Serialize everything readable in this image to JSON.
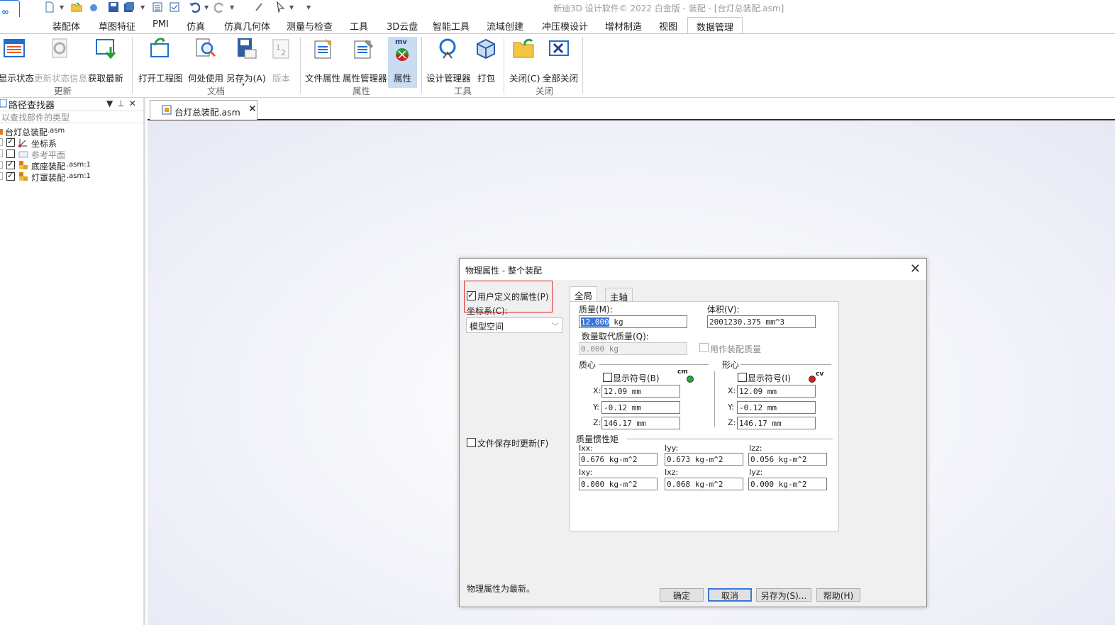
{
  "window": {
    "title": "新迪3D 设计软件© 2022 白金版 - 装配 - [台灯总装配.asm]"
  },
  "tabs": [
    "装配体",
    "草图特征",
    "PMI",
    "仿真",
    "仿真几何体",
    "测量与检查",
    "工具",
    "3D云盘",
    "智能工具",
    "流域创建",
    "冲压模设计",
    "增材制造",
    "视图",
    "数据管理"
  ],
  "active_tab": "数据管理",
  "ribbon": {
    "buttons": [
      "显示状态",
      "更新状态信息",
      "获取最新",
      "打开工程图",
      "何处使用",
      "另存为(A)",
      "版本",
      "文件属性",
      "属性管理器",
      "属性",
      "设计管理器",
      "打包",
      "关闭(C)",
      "全部关闭"
    ],
    "mv_badge": "mv",
    "groups": [
      "更新",
      "文档",
      "属性",
      "工具",
      "关闭"
    ]
  },
  "left_panel": {
    "title": "路径查找器",
    "search_placeholder": "以查找部件的类型",
    "tree": [
      {
        "label": "台灯总装配",
        "suffix": ".asm"
      },
      {
        "label": "坐标系",
        "suffix": ""
      },
      {
        "label": "参考平面",
        "suffix": ""
      },
      {
        "label": "底座装配",
        "suffix": ".asm:1"
      },
      {
        "label": "灯罩装配",
        "suffix": ".asm:1"
      }
    ]
  },
  "document_tab": {
    "name": "台灯总装配.asm"
  },
  "dialog": {
    "title": "物理属性 - 整个装配",
    "user_defined": "用户定义的属性(P)",
    "coord_label": "坐标系(C):",
    "coord_value": "模型空间",
    "update_on_save": "文件保存时更新(F)",
    "tabs": [
      "全局",
      "主轴"
    ],
    "mass_label": "质量(M):",
    "mass_value": "12.000",
    "mass_unit": " kg",
    "volume_label": "体积(V):",
    "volume_value": "2001230.375 mm^3",
    "qty_mass_label": "数量取代质量(Q):",
    "qty_mass_value": "0.000 kg",
    "use_as_assembly_mass": "用作装配质量",
    "centroid_label": "质心",
    "center_of_volume_label": "形心",
    "show_symbol_b": "显示符号(B)",
    "show_symbol_i": "显示符号(I)",
    "cm_badge": "cm",
    "cv_badge": "cv",
    "cm": {
      "x": "12.09 mm",
      "y": "-0.12 mm",
      "z": "146.17 mm"
    },
    "cv": {
      "x": "12.09 mm",
      "y": "-0.12 mm",
      "z": "146.17 mm"
    },
    "axis_labels": [
      "X:",
      "Y:",
      "Z:"
    ],
    "inertia_label": "质量惯性矩",
    "inertia": [
      {
        "label": "Ixx:",
        "value": "0.676 kg-m^2"
      },
      {
        "label": "Iyy:",
        "value": "0.673 kg-m^2"
      },
      {
        "label": "Izz:",
        "value": "0.056 kg-m^2"
      },
      {
        "label": "Ixy:",
        "value": "0.000 kg-m^2"
      },
      {
        "label": "Ixz:",
        "value": "0.068 kg-m^2"
      },
      {
        "label": "Iyz:",
        "value": "0.000 kg-m^2"
      }
    ],
    "status": "物理属性为最新。",
    "buttons": {
      "ok": "确定",
      "cancel": "取消",
      "save_as": "另存为(S)...",
      "help": "帮助(H)"
    }
  },
  "colors": {
    "accent": "#1d6fd1",
    "highlight_box": "#e02a2a",
    "cm_dot": "#1fae3a",
    "cv_dot": "#d62020",
    "selected_button": "#c9dcf2"
  }
}
